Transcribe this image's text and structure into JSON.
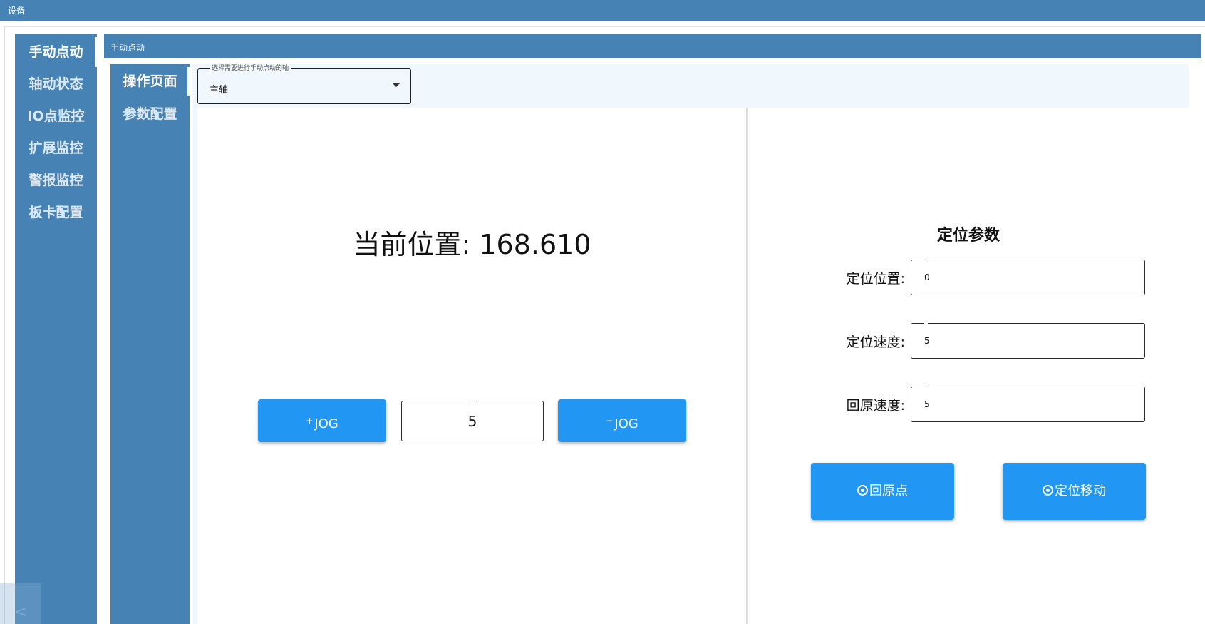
{
  "window": {
    "title": "设备"
  },
  "main_nav": {
    "items": [
      {
        "label": "手动点动",
        "active": true
      },
      {
        "label": "轴动状态",
        "active": false
      },
      {
        "label": "IO点监控",
        "active": false
      },
      {
        "label": "扩展监控",
        "active": false
      },
      {
        "label": "警报监控",
        "active": false
      },
      {
        "label": "板卡配置",
        "active": false
      }
    ],
    "collapse_glyph": "<"
  },
  "page_header": {
    "title": "手动点动"
  },
  "sub_nav": {
    "items": [
      {
        "label": "操作页面",
        "active": true
      },
      {
        "label": "参数配置",
        "active": false
      }
    ]
  },
  "axis_select": {
    "legend": "选择需要进行手动点动的轴",
    "value": "主轴"
  },
  "jog": {
    "position_label": "当前位置: 168.610",
    "plus_sign": "+",
    "plus_label": "JOG",
    "minus_sign": "−",
    "minus_label": "JOG",
    "step_value": "5"
  },
  "positioning": {
    "title": "定位参数",
    "position_label": "定位位置:",
    "position_value": "0",
    "speed_label": "定位速度:",
    "speed_value": "5",
    "home_speed_label": "回原速度:",
    "home_speed_value": "5",
    "home_button": "回原点",
    "move_button": "定位移动"
  },
  "colors": {
    "header": "#4682b4",
    "button": "#2196f3",
    "content_bg": "#f0f7fd"
  }
}
